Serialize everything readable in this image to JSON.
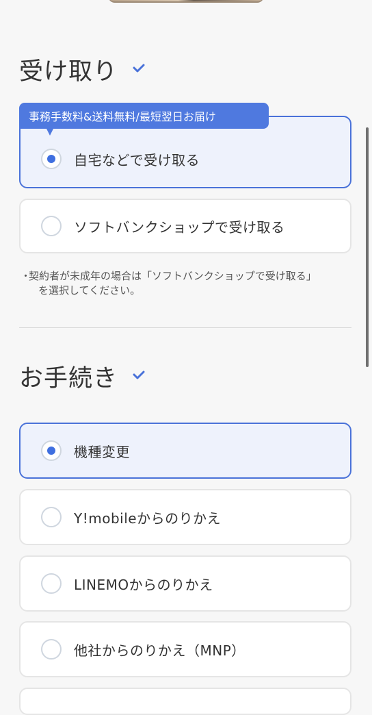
{
  "section1": {
    "title": "受け取り",
    "check_icon": "check-icon",
    "badge": "事務手数料&送料無料/最短翌日お届け",
    "options": [
      {
        "label": "自宅などで受け取る",
        "selected": true
      },
      {
        "label": "ソフトバンクショップで受け取る",
        "selected": false
      }
    ],
    "note_line1": "契約者が未成年の場合は「ソフトバンクショップで受け取る」",
    "note_line2": "を選択してください。",
    "note_bullet": "・"
  },
  "section2": {
    "title": "お手続き",
    "check_icon": "check-icon",
    "options": [
      {
        "label": "機種変更",
        "selected": true
      },
      {
        "label": "Y!mobileからのりかえ",
        "selected": false
      },
      {
        "label": "LINEMOからのりかえ",
        "selected": false
      },
      {
        "label": "他社からのりかえ（MNP）",
        "selected": false
      }
    ]
  },
  "colors": {
    "accent": "#4a72d9",
    "badge": "#4f79df",
    "selected_bg": "#eef2fc",
    "page_bg": "#f7f7f7"
  }
}
